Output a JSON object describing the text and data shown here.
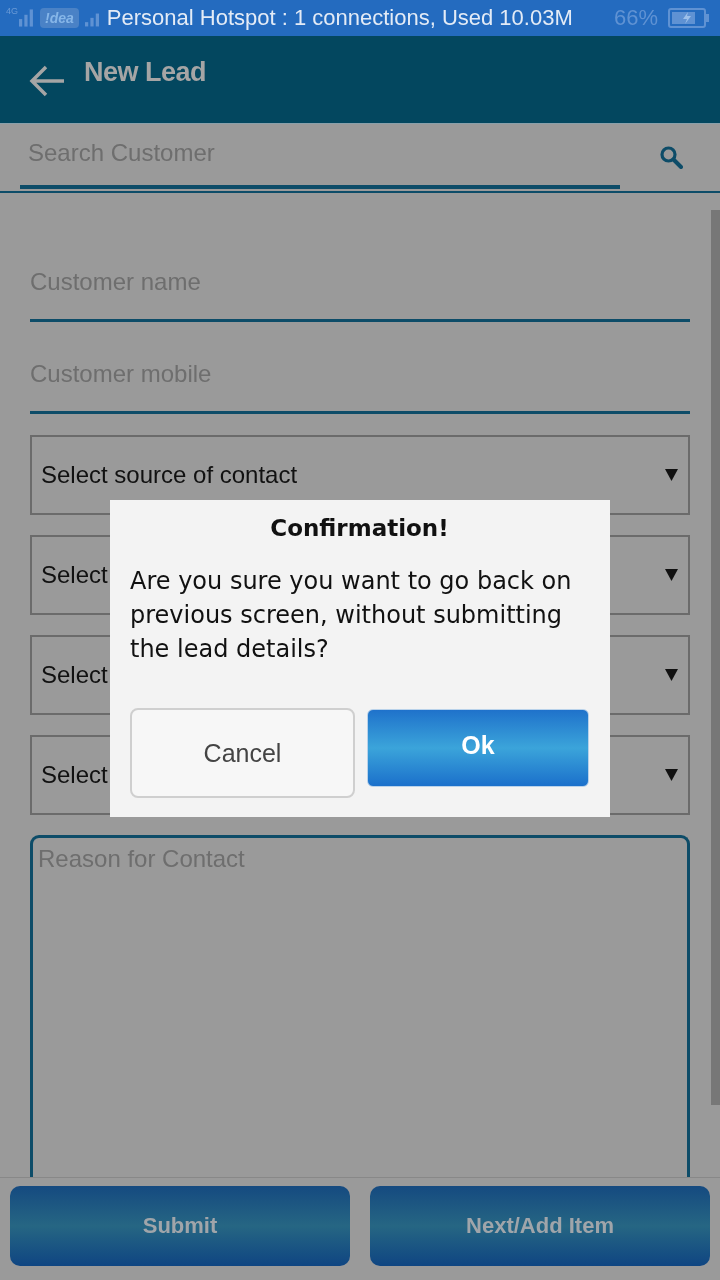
{
  "status_bar": {
    "network": "4G",
    "carrier": "!dea",
    "notification": "Personal Hotspot : 1 connections, Used 10.03M",
    "battery": "66%"
  },
  "app_bar": {
    "title": "New Lead"
  },
  "search": {
    "placeholder": "Search Customer"
  },
  "form": {
    "fields": [
      {
        "kind": "text",
        "placeholder": "Customer name"
      },
      {
        "kind": "text",
        "placeholder": "Customer mobile"
      },
      {
        "kind": "dropdown",
        "label": "Select source of contact"
      },
      {
        "kind": "dropdown",
        "label": "Select"
      },
      {
        "kind": "dropdown",
        "label": "Select"
      },
      {
        "kind": "dropdown",
        "label": "Select"
      },
      {
        "kind": "textarea",
        "placeholder": "Reason for Contact"
      }
    ]
  },
  "actions": [
    {
      "label": "Submit"
    },
    {
      "label": "Next/Add Item"
    }
  ],
  "dialog": {
    "title": "Confirmation!",
    "message": "Are you sure you want to go back on previous screen, without submitting the lead details?",
    "buttons": [
      {
        "kind": "secondary",
        "label": "Cancel"
      },
      {
        "kind": "primary",
        "label": "Ok"
      }
    ]
  }
}
